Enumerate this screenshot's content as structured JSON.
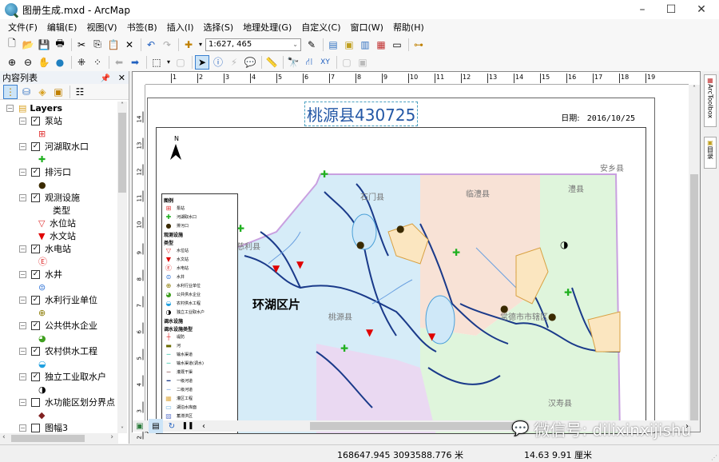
{
  "window": {
    "title": "图册生成.mxd - ArcMap",
    "minimize": "–",
    "maximize": "☐",
    "close": "✕"
  },
  "menu": [
    "文件(F)",
    "编辑(E)",
    "视图(V)",
    "书签(B)",
    "插入(I)",
    "选择(S)",
    "地理处理(G)",
    "自定义(C)",
    "窗口(W)",
    "帮助(H)"
  ],
  "toolbar1": {
    "scale": "1:627, 465"
  },
  "toc": {
    "title": "内容列表",
    "pin": "ᵠ",
    "close": "✕",
    "root": "Layers",
    "layers": [
      {
        "name": "泵站",
        "checked": true,
        "symbol": "pump-station",
        "glyph": "⊞",
        "color": "#e03030"
      },
      {
        "name": "河湖取水口",
        "checked": true,
        "symbol": "intake",
        "glyph": "✚",
        "color": "#20b020"
      },
      {
        "name": "排污口",
        "checked": true,
        "symbol": "outfall",
        "glyph": "●",
        "color": "#3a2a00"
      },
      {
        "name": "观测设施",
        "checked": true,
        "sub_label": "类型",
        "classes": [
          {
            "name": "水位站",
            "glyph": "▽",
            "color": "#e03030"
          },
          {
            "name": "水文站",
            "glyph": "▼",
            "color": "#e00000"
          }
        ]
      },
      {
        "name": "水电站",
        "checked": true,
        "symbol": "hydropower",
        "glyph": "Ⓔ",
        "color": "#e03030"
      },
      {
        "name": "水井",
        "checked": true,
        "symbol": "well",
        "glyph": "⊜",
        "color": "#3a7ad8"
      },
      {
        "name": "水利行业单位",
        "checked": true,
        "symbol": "unit",
        "glyph": "⊕",
        "color": "#8a7a00"
      },
      {
        "name": "公共供水企业",
        "checked": true,
        "symbol": "public-water",
        "glyph": "◕",
        "color": "#40a020"
      },
      {
        "name": "农村供水工程",
        "checked": true,
        "symbol": "rural-water",
        "glyph": "◒",
        "color": "#20a0e0"
      },
      {
        "name": "独立工业取水户",
        "checked": true,
        "symbol": "industrial",
        "glyph": "◑",
        "color": "#000"
      },
      {
        "name": "水功能区划分界点",
        "checked": false,
        "symbol": "boundary-point",
        "glyph": "◆",
        "color": "#802020"
      },
      {
        "name": "图幅3",
        "checked": false
      }
    ]
  },
  "layout": {
    "ruler_h": [
      "1",
      "2",
      "3",
      "4",
      "5",
      "6",
      "7",
      "8",
      "9",
      "10",
      "11",
      "12",
      "13",
      "14",
      "15",
      "16",
      "17",
      "18",
      "19"
    ],
    "ruler_v": [
      "14",
      "13",
      "12",
      "11",
      "10",
      "9",
      "8",
      "7",
      "6",
      "5",
      "4",
      "3",
      "2"
    ],
    "map_title": "桃源县430725",
    "date_label": "日期:",
    "date_value": "2016/10/25",
    "north": "N",
    "region_labels": [
      "安乡县",
      "澧县",
      "临澧县",
      "石门县",
      "慈利县",
      "环湖区片",
      "桃源县",
      "常德市市辖区",
      "汉寿县"
    ],
    "legend": {
      "title": "图例",
      "items1": [
        {
          "label": "泵站",
          "glyph": "⊞",
          "color": "#e03030"
        },
        {
          "label": "河湖取水口",
          "glyph": "✚",
          "color": "#20b020"
        },
        {
          "label": "排污口",
          "glyph": "●",
          "color": "#3a2a00"
        }
      ],
      "h2": "观测设施",
      "h3": "类型",
      "items2": [
        {
          "label": "水位站",
          "glyph": "▽",
          "color": "#e03030"
        },
        {
          "label": "水文站",
          "glyph": "▼",
          "color": "#e00000"
        },
        {
          "label": "水电站",
          "glyph": "Ⓔ",
          "color": "#e03030"
        },
        {
          "label": "水井",
          "glyph": "⊜",
          "color": "#3a7ad8"
        },
        {
          "label": "水利行业单位",
          "glyph": "⊕",
          "color": "#8a7a00"
        },
        {
          "label": "公共供水企业",
          "glyph": "◕",
          "color": "#40a020"
        },
        {
          "label": "农村供水工程",
          "glyph": "◒",
          "color": "#20a0e0"
        },
        {
          "label": "独立工业取水户",
          "glyph": "◑",
          "color": "#000"
        }
      ],
      "h4": "调水设施",
      "h5": "调水设施类型",
      "items3": [
        {
          "label": "堤防",
          "glyph": "┼",
          "color": "#e03030"
        },
        {
          "label": "河",
          "glyph": "▬",
          "color": "#6a6a00"
        },
        {
          "label": "输水渠道",
          "glyph": "─",
          "color": "#20c0a0"
        },
        {
          "label": "输水渠道(调水)",
          "glyph": "─",
          "color": "#20c0a0"
        },
        {
          "label": "灌溉干渠",
          "glyph": "─",
          "color": "#804040"
        },
        {
          "label": "一级河道",
          "glyph": "━",
          "color": "#1a3a8a"
        },
        {
          "label": "二级河道",
          "glyph": "─",
          "color": "#6aa0e0"
        },
        {
          "label": "灌区工程",
          "glyph": "▦",
          "color": "#e0b050"
        },
        {
          "label": "湖泊水库面",
          "glyph": "▭",
          "color": "#6ab0e0"
        },
        {
          "label": "蓄滞洪区",
          "glyph": "▨",
          "color": "#6a80d0"
        }
      ]
    }
  },
  "right_dock": {
    "tab1": "ArcToolbox",
    "tab2": "目录"
  },
  "status": {
    "coords": "168647.945  3093588.776 米",
    "page_coords": "14.63  9.91 厘米"
  },
  "watermark": "微信号: dilixinxijishu"
}
